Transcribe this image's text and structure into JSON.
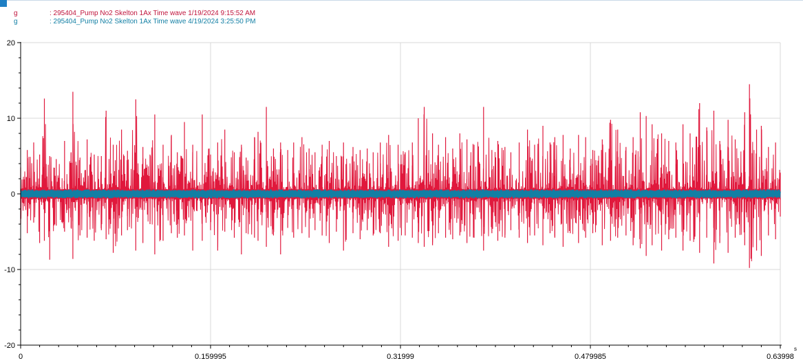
{
  "colors": {
    "series1": "#e0183c",
    "series2": "#127fa4",
    "grid": "#d8d8d8",
    "axis": "#000000"
  },
  "legend": [
    {
      "unit": "g",
      "text": ": 295404_Pump No2 Skelton 1Ax Time wave 1/19/2024 9:15:52 AM",
      "color": "#c0143c"
    },
    {
      "unit": "g",
      "text": ": 295404_Pump No2 Skelton 1Ax Time wave 4/19/2024 3:25:50 PM",
      "color": "#127fa4"
    }
  ],
  "chart_data": {
    "type": "line",
    "title": "",
    "xlabel": "s",
    "ylabel": "",
    "xlim": [
      0,
      0.63998
    ],
    "ylim": [
      -20,
      20
    ],
    "grid": true,
    "legend_position": "top-left",
    "x_ticks": [
      "0",
      "0.159995",
      "0.31999",
      "0.479985",
      "0.63998"
    ],
    "y_ticks": [
      "20",
      "10",
      "0",
      "-10",
      "-20"
    ],
    "series": [
      {
        "name": "295404_Pump No2 Skelton 1Ax Time wave 1/19/2024 9:15:52 AM",
        "color": "#e0183c",
        "peaks": [
          [
            0.0,
            3.5,
            -4
          ],
          [
            0.0056,
            5.8,
            -5.2
          ],
          [
            0.011,
            6.8,
            -3.8
          ],
          [
            0.016,
            5.2,
            -6.5
          ],
          [
            0.02,
            12.6,
            -6.2
          ],
          [
            0.0245,
            5,
            -8.7
          ],
          [
            0.03,
            4.6,
            -4.2
          ],
          [
            0.037,
            7,
            -5
          ],
          [
            0.0425,
            5.5,
            -4.5
          ],
          [
            0.044,
            13.5,
            -8.6
          ],
          [
            0.05,
            4.8,
            -5.5
          ],
          [
            0.056,
            7.2,
            -5.8
          ],
          [
            0.062,
            5.2,
            -6.2
          ],
          [
            0.068,
            5,
            -4.8
          ],
          [
            0.072,
            11,
            -6
          ],
          [
            0.078,
            6.5,
            -7.8
          ],
          [
            0.085,
            8.5,
            -5.5
          ],
          [
            0.09,
            5.7,
            -4.8
          ],
          [
            0.097,
            12.5,
            -7.5
          ],
          [
            0.103,
            6.2,
            -6.5
          ],
          [
            0.109,
            5.2,
            -4
          ],
          [
            0.113,
            10.5,
            -8
          ],
          [
            0.12,
            6.5,
            -6.2
          ],
          [
            0.127,
            7.8,
            -5.2
          ],
          [
            0.132,
            5.5,
            -5.8
          ],
          [
            0.138,
            9.5,
            -5.5
          ],
          [
            0.145,
            6.5,
            -7.5
          ],
          [
            0.153,
            10.5,
            -6.2
          ],
          [
            0.16,
            5.2,
            -4.8
          ],
          [
            0.166,
            6.8,
            -7.5
          ],
          [
            0.172,
            8.5,
            -5
          ],
          [
            0.18,
            5.5,
            -5.8
          ],
          [
            0.186,
            6.5,
            -8
          ],
          [
            0.19,
            4.8,
            -5.2
          ],
          [
            0.197,
            7.5,
            -5.8
          ],
          [
            0.2,
            8.2,
            -6.2
          ],
          [
            0.207,
            11.5,
            -7
          ],
          [
            0.213,
            6,
            -5.5
          ],
          [
            0.219,
            6.8,
            -8
          ],
          [
            0.225,
            5.8,
            -4.5
          ],
          [
            0.23,
            6.8,
            -5.8
          ],
          [
            0.237,
            7.5,
            -5.2
          ],
          [
            0.243,
            6,
            -5.8
          ],
          [
            0.248,
            5.5,
            -4.8
          ],
          [
            0.254,
            6.5,
            -5.5
          ],
          [
            0.26,
            7,
            -6.5
          ],
          [
            0.266,
            5,
            -5
          ],
          [
            0.272,
            6.8,
            -7.5
          ],
          [
            0.28,
            6.2,
            -5.2
          ],
          [
            0.286,
            5.8,
            -6
          ],
          [
            0.292,
            6,
            -4.8
          ],
          [
            0.297,
            5.5,
            -5.5
          ],
          [
            0.303,
            6.8,
            -5.2
          ],
          [
            0.31,
            7.8,
            -7
          ],
          [
            0.318,
            6.5,
            -6.2
          ],
          [
            0.324,
            5.5,
            -5.5
          ],
          [
            0.33,
            6.8,
            -5.8
          ],
          [
            0.335,
            10,
            -6.5
          ],
          [
            0.34,
            11.5,
            -7
          ],
          [
            0.347,
            8,
            -6.8
          ],
          [
            0.352,
            6.5,
            -5.2
          ],
          [
            0.358,
            7.5,
            -5.8
          ],
          [
            0.364,
            6,
            -6
          ],
          [
            0.37,
            8,
            -5.5
          ],
          [
            0.376,
            7.2,
            -6.5
          ],
          [
            0.382,
            6.5,
            -5.8
          ],
          [
            0.39,
            11.5,
            -7.5
          ],
          [
            0.397,
            5.8,
            -5.2
          ],
          [
            0.402,
            7,
            -6.2
          ],
          [
            0.408,
            6.2,
            -5.8
          ],
          [
            0.413,
            5.5,
            -4.8
          ],
          [
            0.42,
            6.8,
            -5.8
          ],
          [
            0.427,
            8.5,
            -6.5
          ],
          [
            0.433,
            6.5,
            -5.5
          ],
          [
            0.44,
            9,
            -6.8
          ],
          [
            0.446,
            6.8,
            -5.2
          ],
          [
            0.45,
            7.5,
            -5.8
          ],
          [
            0.457,
            7.8,
            -7
          ],
          [
            0.463,
            6,
            -5.2
          ],
          [
            0.47,
            7.8,
            -6.5
          ],
          [
            0.476,
            7.5,
            -5.8
          ],
          [
            0.482,
            5.8,
            -5.2
          ],
          [
            0.49,
            7.2,
            -6.8
          ],
          [
            0.497,
            9.8,
            -6.2
          ],
          [
            0.503,
            8.5,
            -5.8
          ],
          [
            0.51,
            6.2,
            -5.5
          ],
          [
            0.516,
            7.5,
            -6.8
          ],
          [
            0.522,
            10.8,
            -7.2
          ],
          [
            0.527,
            10.3,
            -8.2
          ],
          [
            0.532,
            9.2,
            -6.8
          ],
          [
            0.54,
            8,
            -7.5
          ],
          [
            0.546,
            7,
            -6
          ],
          [
            0.552,
            6.8,
            -5.8
          ],
          [
            0.558,
            9.2,
            -7.5
          ],
          [
            0.564,
            8,
            -6.2
          ],
          [
            0.572,
            12,
            -7.8
          ],
          [
            0.578,
            8.8,
            -5.8
          ],
          [
            0.584,
            11,
            -9.2
          ],
          [
            0.589,
            7,
            -6.5
          ],
          [
            0.596,
            9.8,
            -7.8
          ],
          [
            0.602,
            7.2,
            -5.8
          ],
          [
            0.61,
            10.8,
            -6.8
          ],
          [
            0.614,
            14.5,
            -9.8
          ],
          [
            0.62,
            8.5,
            -7.5
          ],
          [
            0.624,
            9,
            -8.2
          ],
          [
            0.63,
            6.2,
            -5.5
          ],
          [
            0.636,
            6.8,
            -6
          ],
          [
            0.63998,
            2.8,
            -3
          ]
        ]
      },
      {
        "name": "295404_Pump No2 Skelton 1Ax Time wave 4/19/2024 3:25:50 PM",
        "color": "#127fa4",
        "amplitude_min": -0.6,
        "amplitude_max": 0.6
      }
    ]
  }
}
